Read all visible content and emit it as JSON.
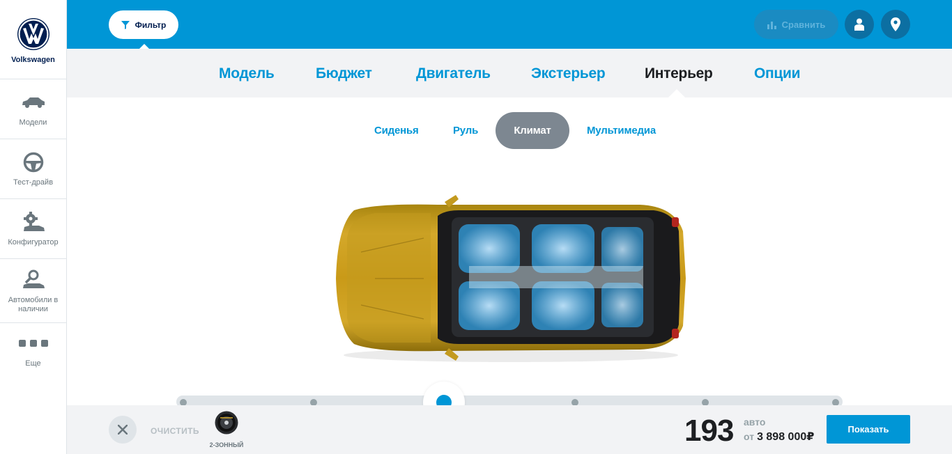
{
  "sidebar": {
    "brand": "Volkswagen",
    "items": [
      {
        "label": "Модели",
        "icon": "car-icon"
      },
      {
        "label": "Тест-драйв",
        "icon": "steering-wheel-icon"
      },
      {
        "label": "Конфигуратор",
        "icon": "configurator-gear-car-icon"
      },
      {
        "label": "Автомобили в наличии",
        "icon": "car-search-icon"
      },
      {
        "label": "Еще",
        "icon": "more-dots-icon"
      }
    ]
  },
  "topbar": {
    "filter_label": "Фильтр",
    "compare_label": "Сравнить",
    "colors": {
      "bar": "#0096d6",
      "compare_bg": "#1a8bc2"
    }
  },
  "main_tabs": [
    {
      "label": "Модель"
    },
    {
      "label": "Бюджет"
    },
    {
      "label": "Двигатель"
    },
    {
      "label": "Экстерьер"
    },
    {
      "label": "Интерьер",
      "active": true
    },
    {
      "label": "Опции"
    }
  ],
  "sub_tabs": [
    {
      "label": "Сиденья"
    },
    {
      "label": "Руль"
    },
    {
      "label": "Климат",
      "active": true
    },
    {
      "label": "Мультимедиа"
    }
  ],
  "slider": {
    "stops": 6,
    "selected_index": 2
  },
  "bottom": {
    "clear_label": "ОЧИСТИТЬ",
    "chip_caption": "2-ЗОННЫЙ",
    "count": "193",
    "count_unit": "авто",
    "price_from": "от",
    "price": "3 898 000₽",
    "show_label": "Показать"
  }
}
